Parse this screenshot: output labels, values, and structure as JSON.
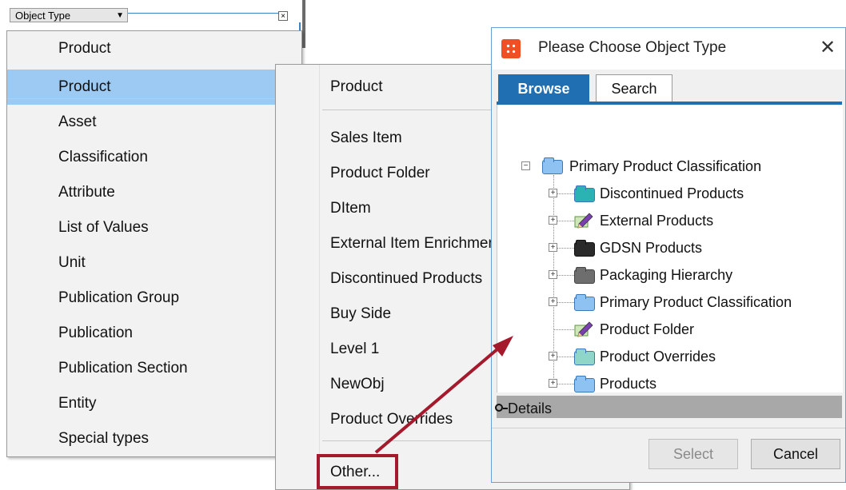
{
  "filter": {
    "object_type_label": "Object Type",
    "clear_glyph": "×"
  },
  "menu1": {
    "items": [
      {
        "label": "Product",
        "has_sub": false
      },
      {
        "label": "Product",
        "has_sub": true
      },
      {
        "label": "Asset",
        "has_sub": true
      },
      {
        "label": "Classification",
        "has_sub": true
      },
      {
        "label": "Attribute",
        "has_sub": false
      },
      {
        "label": "List of Values",
        "has_sub": false
      },
      {
        "label": "Unit",
        "has_sub": false
      },
      {
        "label": "Publication Group",
        "has_sub": true
      },
      {
        "label": "Publication",
        "has_sub": true
      },
      {
        "label": "Publication Section",
        "has_sub": true
      },
      {
        "label": "Entity",
        "has_sub": true
      },
      {
        "label": "Special types",
        "has_sub": true
      }
    ],
    "submenu_glyph": "›",
    "selected_index": 1
  },
  "menu2": {
    "items": [
      "Product",
      "Sales Item",
      "Product Folder",
      "DItem",
      "External Item Enrichment",
      "Discontinued Products",
      "Buy Side",
      "Level 1",
      "NewObj",
      "Product Overrides",
      "Other..."
    ]
  },
  "dialog": {
    "title": "Please Choose Object Type",
    "close_glyph": "✕",
    "tabs": {
      "browse": "Browse",
      "search": "Search",
      "active": "Browse"
    },
    "tree": {
      "root": {
        "label": "Primary Product Classification",
        "expander": "⊟",
        "icon": "folder-icon",
        "color": "#8ec2f2"
      },
      "children": [
        {
          "label": "Discontinued Products",
          "icon": "folder-icon",
          "color": "#2bb3b3",
          "expander": "+"
        },
        {
          "label": "External Products",
          "icon": "pencil-icon",
          "color": "#6fbf4a",
          "expander": "+"
        },
        {
          "label": "GDSN Products",
          "icon": "folder-icon",
          "color": "#2a2a2a",
          "expander": "+"
        },
        {
          "label": "Packaging Hierarchy",
          "icon": "folder-icon",
          "color": "#6e6e6e",
          "expander": "+"
        },
        {
          "label": "Primary Product Classification",
          "icon": "folder-icon",
          "color": "#8ec2f2",
          "expander": "+"
        },
        {
          "label": "Product Folder",
          "icon": "pencil-icon",
          "color": "#6fbf4a",
          "expander": ""
        },
        {
          "label": "Product Overrides",
          "icon": "folder-icon",
          "color": "#8fd6c8",
          "expander": "+"
        },
        {
          "label": "Products",
          "icon": "folder-icon",
          "color": "#8ec2f2",
          "expander": "+"
        }
      ]
    },
    "details_label": "Details",
    "buttons": {
      "select": "Select",
      "cancel": "Cancel"
    }
  },
  "annotation": {
    "highlight_color": "#a5192d"
  }
}
